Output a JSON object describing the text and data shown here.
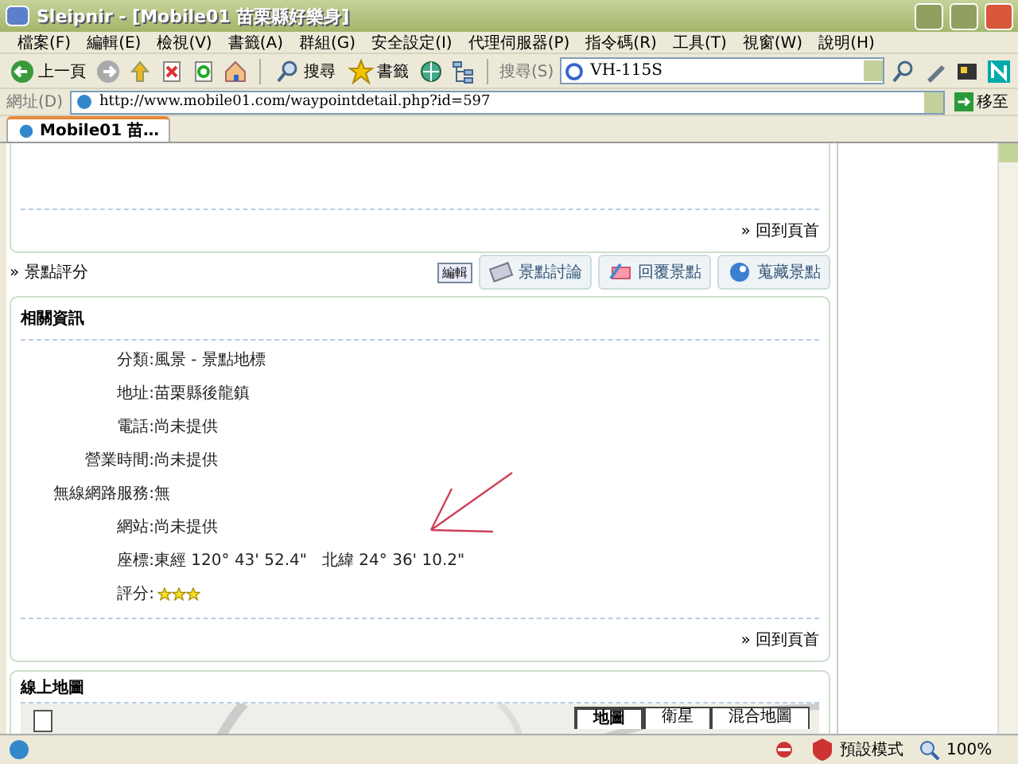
{
  "window": {
    "title": "Sleipnir - [Mobile01 苗栗縣好樂身]"
  },
  "menu": [
    "檔案(F)",
    "編輯(E)",
    "檢視(V)",
    "書籤(A)",
    "群組(G)",
    "安全設定(I)",
    "代理伺服器(P)",
    "指令碼(R)",
    "工具(T)",
    "視窗(W)",
    "說明(H)"
  ],
  "toolbar": {
    "back_label": "上一頁",
    "search_label": "搜尋",
    "bookmarks_label": "書籤"
  },
  "search": {
    "label": "搜尋(S)",
    "value": "VH-115S"
  },
  "address": {
    "label": "網址(D)",
    "value": "http://www.mobile01.com/waypointdetail.php?id=597",
    "go_label": "移至"
  },
  "tabs": [
    {
      "label": "Mobile01 苗…",
      "selected": true
    }
  ],
  "top_card": {
    "back_to_top": "» 回到頁首"
  },
  "rating_bar": {
    "label": "» 景點評分",
    "buttons": [
      {
        "label": "編輯",
        "kind": "small"
      },
      {
        "label": "景點討論",
        "kind": "icon"
      },
      {
        "label": "回覆景點",
        "kind": "icon"
      },
      {
        "label": "蒐藏景點",
        "kind": "icon"
      }
    ]
  },
  "info_card": {
    "title": "相關資訊",
    "rows": [
      {
        "kind": "text",
        "label": "分類:",
        "value": "風景 - 景點地標"
      },
      {
        "kind": "text",
        "label": "地址:",
        "value": "苗栗縣後龍鎮"
      },
      {
        "kind": "text",
        "label": "電話:",
        "value": "尚未提供"
      },
      {
        "kind": "text",
        "label": "營業時間:",
        "value": "尚未提供"
      },
      {
        "kind": "text",
        "label": "無線網路服務:",
        "value": "無"
      },
      {
        "kind": "text",
        "label": "網站:",
        "value": "尚未提供"
      },
      {
        "kind": "text",
        "label": "座標:",
        "value": "東經 120° 43' 52.4\"   北緯 24° 36' 10.2\""
      },
      {
        "kind": "stars",
        "label": "評分:",
        "stars": 3
      }
    ],
    "back_to_top": "» 回到頁首"
  },
  "map_card": {
    "title": "線上地圖",
    "map_buttons": [
      {
        "label": "地圖",
        "selected": true
      },
      {
        "label": "衛星",
        "selected": false
      },
      {
        "label": "混合地圖",
        "selected": false
      }
    ]
  },
  "status_bar": {
    "mode": "預設模式",
    "zoom": "100%"
  }
}
